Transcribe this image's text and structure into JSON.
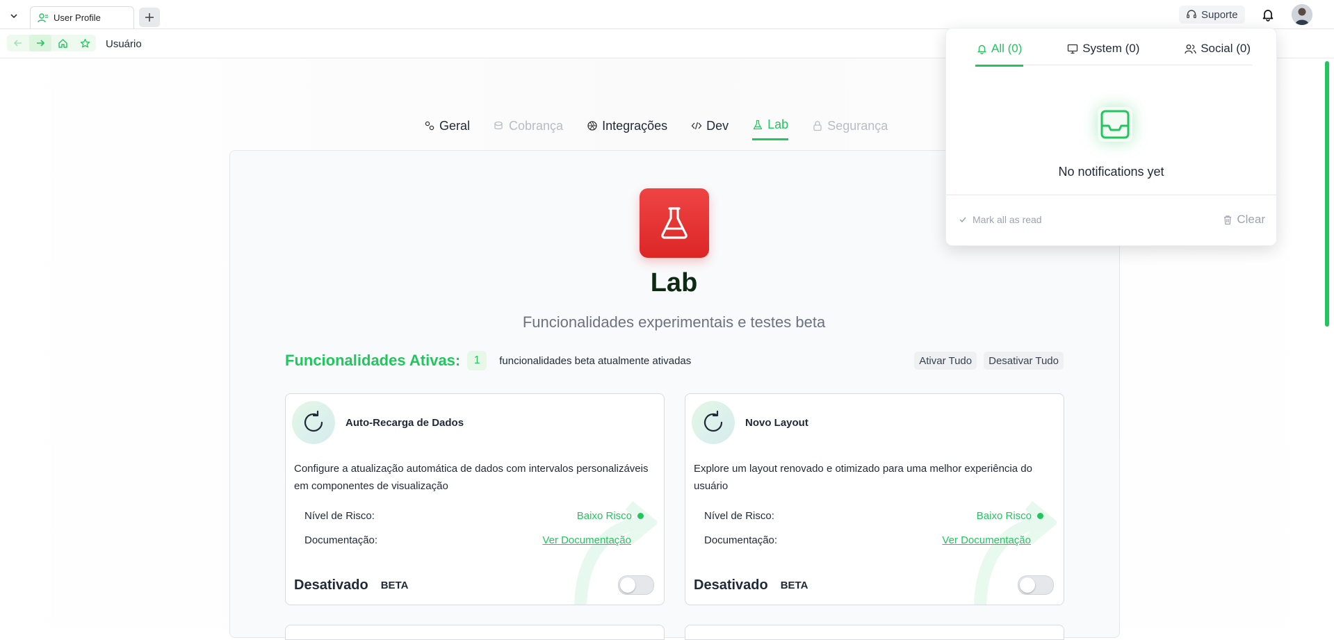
{
  "browser": {
    "tab_title": "User Profile",
    "breadcrumb": "Usuário",
    "support_label": "Suporte"
  },
  "settings_tabs": [
    {
      "label": "Geral",
      "icon": "gears-icon",
      "state": "normal"
    },
    {
      "label": "Cobrança",
      "icon": "coins-icon",
      "state": "disabled"
    },
    {
      "label": "Integrações",
      "icon": "aperture-icon",
      "state": "normal"
    },
    {
      "label": "Dev",
      "icon": "code-icon",
      "state": "normal"
    },
    {
      "label": "Lab",
      "icon": "flask-icon",
      "state": "active"
    },
    {
      "label": "Segurança",
      "icon": "lock-icon",
      "state": "disabled"
    }
  ],
  "lab": {
    "title": "Lab",
    "subtitle": "Funcionalidades experimentais e testes beta",
    "active_label": "Funcionalidades Ativas:",
    "active_count": "1",
    "active_desc": "funcionalidades beta atualmente ativadas",
    "enable_all": "Ativar Tudo",
    "disable_all": "Desativar Tudo"
  },
  "features": [
    {
      "title": "Auto-Recarga de Dados",
      "description": "Configure a atualização automática de dados com intervalos personalizáveis em componentes de visualização",
      "risk_label": "Nível de Risco:",
      "risk_value": "Baixo Risco",
      "doc_label": "Documentação:",
      "doc_link": "Ver Documentação",
      "state": "Desativado",
      "badge": "BETA",
      "enabled": false
    },
    {
      "title": "Novo Layout",
      "description": "Explore um layout renovado e otimizado para uma melhor experiência do usuário",
      "risk_label": "Nível de Risco:",
      "risk_value": "Baixo Risco",
      "doc_label": "Documentação:",
      "doc_link": "Ver Documentação",
      "state": "Desativado",
      "badge": "BETA",
      "enabled": false
    }
  ],
  "notifications": {
    "tabs": [
      "All (0)",
      "System (0)",
      "Social (0)"
    ],
    "active_tab": "All (0)",
    "empty_text": "No notifications yet",
    "mark_all_read": "Mark all as read",
    "clear": "Clear"
  },
  "colors": {
    "accent": "#22c55e",
    "lab_icon": "#ef4444",
    "disabled": "#b8bcc3"
  }
}
